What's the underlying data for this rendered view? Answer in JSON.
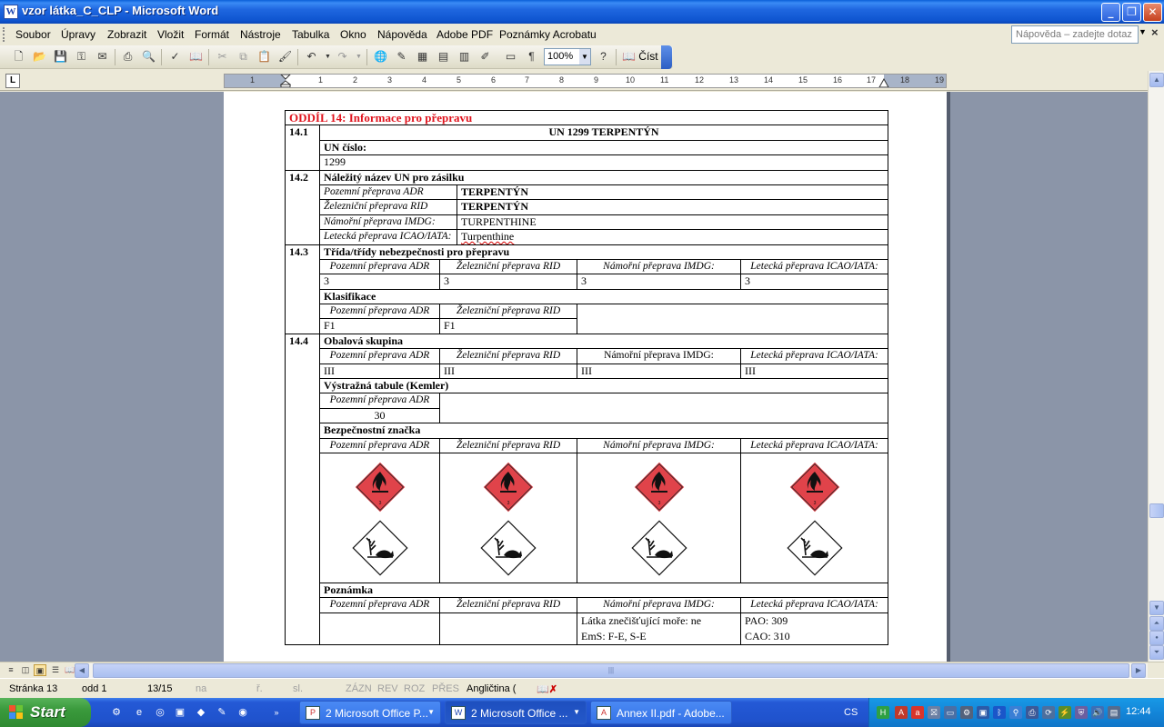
{
  "window": {
    "title": "vzor látka_C_CLP - Microsoft Word",
    "app_icon": "W"
  },
  "menu": {
    "items": [
      "Soubor",
      "Úpravy",
      "Zobrazit",
      "Vložit",
      "Formát",
      "Nástroje",
      "Tabulka",
      "Okno",
      "Nápověda",
      "Adobe PDF",
      "Poznámky Acrobatu"
    ],
    "help_placeholder": "Nápověda – zadejte dotaz"
  },
  "toolbar": {
    "zoom": "100%",
    "read_label": "Číst"
  },
  "ruler": {
    "numbers": [
      "1",
      "1",
      "2",
      "3",
      "4",
      "5",
      "6",
      "7",
      "8",
      "9",
      "10",
      "11",
      "12",
      "13",
      "14",
      "15",
      "16",
      "17",
      "18",
      "19"
    ]
  },
  "document": {
    "section_title": "ODDÍL 14: Informace pro přepravu",
    "s141": {
      "num": "14.1",
      "heading": "UN 1299 TERPENTÝN",
      "un_label": "UN číslo:",
      "un_value": "1299"
    },
    "s142": {
      "num": "14.2",
      "heading": "Náležitý název UN pro zásilku",
      "rows": [
        {
          "mode": "Pozemní přeprava ADR",
          "value": "TERPENTÝN"
        },
        {
          "mode": "Železniční přeprava RID",
          "value": "TERPENTÝN"
        },
        {
          "mode": "Námořní přeprava IMDG:",
          "value": "TURPENTHINE"
        },
        {
          "mode": "Letecká přeprava ICAO/IATA:",
          "value": "Turpenthine"
        }
      ]
    },
    "s143": {
      "num": "14.3",
      "heading": "Třída/třídy nebezpečnosti pro přepravu",
      "modes": [
        "Pozemní přeprava ADR",
        "Železniční přeprava RID",
        "Námořní přeprava IMDG:",
        "Letecká přeprava ICAO/IATA:"
      ],
      "values": [
        "3",
        "3",
        "3",
        "3"
      ],
      "class_heading": "Klasifikace",
      "class_modes": [
        "Pozemní přeprava ADR",
        "Železniční přeprava RID"
      ],
      "class_values": [
        "F1",
        "F1"
      ]
    },
    "s144": {
      "num": "14.4",
      "heading": "Obalová skupina",
      "modes": [
        "Pozemní přeprava ADR",
        "Železniční přeprava RID",
        "Námořní přeprava IMDG:",
        "Letecká přeprava ICAO/IATA:"
      ],
      "values": [
        "III",
        "III",
        "III",
        "III"
      ],
      "kemler_heading": "Výstražná tabule (Kemler)",
      "kemler_mode": "Pozemní přeprava ADR",
      "kemler_value": "30",
      "sign_heading": "Bezpečnostní značka",
      "sign_modes": [
        "Pozemní přeprava ADR",
        "Železniční přeprava RID",
        "Námořní přeprava IMDG:",
        "Letecká přeprava ICAO/IATA:"
      ],
      "note_heading": "Poznámka",
      "note_modes": [
        "Pozemní přeprava ADR",
        "Železniční přeprava RID",
        "Námořní přeprava IMDG:",
        "Letecká přeprava ICAO/IATA:"
      ],
      "note_imdg": [
        "Látka znečišťující moře: ne",
        "EmS: F-E, S-E"
      ],
      "note_icao": [
        "PAO: 309",
        "CAO: 310"
      ]
    }
  },
  "statusbar": {
    "page": "Stránka  13",
    "section": "odd  1",
    "pages": "13/15",
    "at": "na",
    "line": "ř.",
    "col": "sl.",
    "rec": "ZÁZN",
    "trk": "REV",
    "ext": "ROZ",
    "ovr": "PŘES",
    "language": "Angličtina ("
  },
  "taskbar": {
    "start_label": "Start",
    "tasks": [
      {
        "label": "2 Microsoft Office P...",
        "icon": "P"
      },
      {
        "label": "2 Microsoft Office ...",
        "icon": "W"
      },
      {
        "label": "Annex II.pdf - Adobe...",
        "icon": "A"
      }
    ],
    "language": "CS",
    "clock": "12:44"
  },
  "colors": {
    "accent": "#0a5fd8",
    "section_title": "#e0141e",
    "taskbar": "#2459d6",
    "tray": "#1386d9"
  }
}
